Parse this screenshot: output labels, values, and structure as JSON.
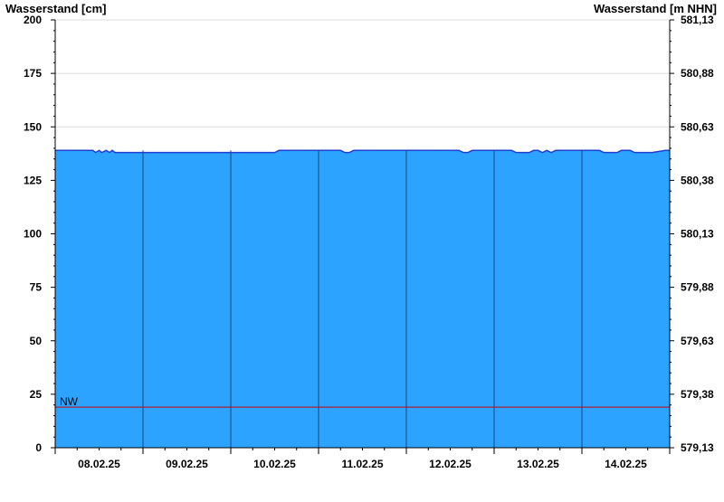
{
  "chart_data": {
    "type": "area",
    "ylabel_left": "Wasserstand [cm]",
    "ylabel_right": "Wasserstand [m NHN]",
    "ylim": [
      0,
      200
    ],
    "yticks_left": [
      {
        "value": 0,
        "label": "0"
      },
      {
        "value": 25,
        "label": "25"
      },
      {
        "value": 50,
        "label": "50"
      },
      {
        "value": 75,
        "label": "75"
      },
      {
        "value": 100,
        "label": "100"
      },
      {
        "value": 125,
        "label": "125"
      },
      {
        "value": 150,
        "label": "150"
      },
      {
        "value": 175,
        "label": "175"
      },
      {
        "value": 200,
        "label": "200"
      }
    ],
    "yticks_right": [
      {
        "value": 0,
        "label": "579,13"
      },
      {
        "value": 25,
        "label": "579,38"
      },
      {
        "value": 50,
        "label": "579,63"
      },
      {
        "value": 75,
        "label": "579,88"
      },
      {
        "value": 100,
        "label": "580,13"
      },
      {
        "value": 125,
        "label": "580,38"
      },
      {
        "value": 150,
        "label": "580,63"
      },
      {
        "value": 175,
        "label": "580,88"
      },
      {
        "value": 200,
        "label": "581,13"
      }
    ],
    "xlim": [
      0,
      7
    ],
    "day_labels": [
      "08.02.25",
      "09.02.25",
      "10.02.25",
      "11.02.25",
      "12.02.25",
      "13.02.25",
      "14.02.25"
    ],
    "day_boundaries": [
      1,
      2,
      3,
      4,
      5,
      6
    ],
    "grid": true,
    "nw": {
      "label": "NW",
      "value": 19,
      "color": "#cc0000"
    },
    "fill_color": "#2ca3ff",
    "line_color": "#1f3fd0",
    "series": [
      {
        "x": [
          0,
          0.43,
          0.46,
          0.5,
          0.53,
          0.58,
          0.62,
          0.65,
          0.68,
          0.7,
          1.0,
          1.5,
          2.0,
          2.5,
          2.55,
          2.6,
          3.0,
          3.25,
          3.3,
          3.35,
          3.4,
          3.45,
          3.5,
          4.0,
          4.5,
          4.6,
          4.65,
          4.7,
          4.75,
          4.8,
          5.0,
          5.2,
          5.25,
          5.4,
          5.45,
          5.5,
          5.55,
          5.6,
          5.65,
          5.7,
          5.8,
          5.9,
          6.0,
          6.2,
          6.25,
          6.4,
          6.45,
          6.55,
          6.6,
          6.8,
          6.95,
          7.0
        ],
        "y": [
          139,
          139,
          138,
          139,
          138,
          139,
          138,
          139,
          138,
          138,
          138,
          138,
          138,
          138,
          139,
          139,
          139,
          139,
          138,
          138,
          139,
          139,
          139,
          139,
          139,
          139,
          138,
          138,
          139,
          139,
          139,
          139,
          138,
          138,
          139,
          139,
          138,
          139,
          138,
          139,
          139,
          139,
          139,
          139,
          138,
          138,
          139,
          139,
          138,
          138,
          139,
          139
        ]
      }
    ]
  }
}
